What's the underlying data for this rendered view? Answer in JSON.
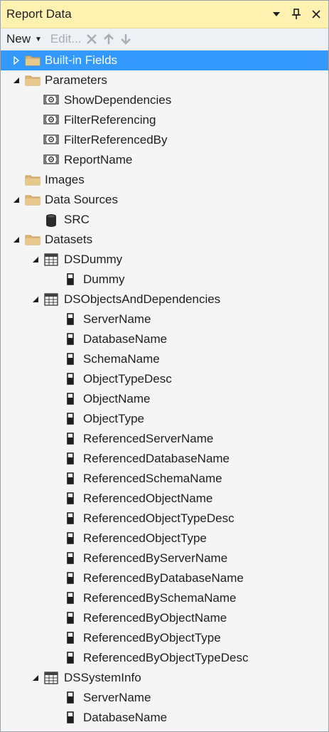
{
  "window": {
    "title": "Report Data"
  },
  "toolbar": {
    "new_label": "New",
    "edit_label": "Edit..."
  },
  "tree": {
    "built_in_fields": "Built-in Fields",
    "parameters": {
      "label": "Parameters",
      "items": [
        "ShowDependencies",
        "FilterReferencing",
        "FilterReferencedBy",
        "ReportName"
      ]
    },
    "images": "Images",
    "data_sources": {
      "label": "Data Sources",
      "items": [
        "SRC"
      ]
    },
    "datasets": {
      "label": "Datasets",
      "items": [
        {
          "name": "DSDummy",
          "fields": [
            "Dummy"
          ]
        },
        {
          "name": "DSObjectsAndDependencies",
          "fields": [
            "ServerName",
            "DatabaseName",
            "SchemaName",
            "ObjectTypeDesc",
            "ObjectName",
            "ObjectType",
            "ReferencedServerName",
            "ReferencedDatabaseName",
            "ReferencedSchemaName",
            "ReferencedObjectName",
            "ReferencedObjectTypeDesc",
            "ReferencedObjectType",
            "ReferencedByServerName",
            "ReferencedByDatabaseName",
            "ReferencedBySchemaName",
            "ReferencedByObjectName",
            "ReferencedByObjectType",
            "ReferencedByObjectTypeDesc"
          ]
        },
        {
          "name": "DSSystemInfo",
          "fields": [
            "ServerName",
            "DatabaseName"
          ]
        }
      ]
    }
  }
}
